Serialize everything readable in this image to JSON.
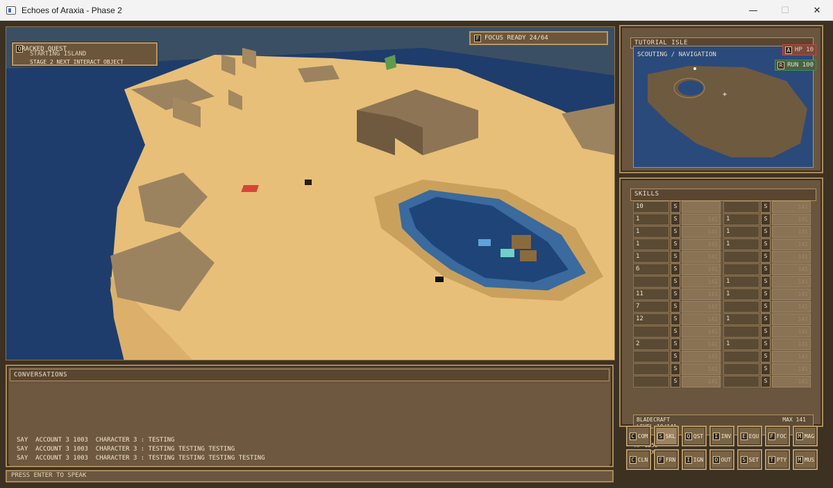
{
  "window": {
    "title": "Echoes of Araxia - Phase 2",
    "minimize": "—",
    "maximize": "☐",
    "close": "✕"
  },
  "quest": {
    "key": "Q",
    "label": "RACKED QUEST",
    "zone": "STARTING ISLAND",
    "stage": "STAGE 2  NEXT INTERACT OBJECT"
  },
  "focus": {
    "key": "F",
    "label": "FOCUS READY",
    "value": "24/64"
  },
  "minimap": {
    "title": "TUTORIAL ISLE",
    "subtitle": "SCOUTING / NAVIGATION",
    "hp": {
      "key": "A",
      "label": "HP 10",
      "color": "#cc4444"
    },
    "run": {
      "key": "R",
      "label": "RUN 100",
      "color": "#3e8f55"
    }
  },
  "skills": {
    "title": "SKILLS",
    "rows": [
      [
        {
          "lvl": "10",
          "ico": "S",
          "bar": "",
          "dim": false
        },
        {
          "lvl": "",
          "ico": "S",
          "bar": "141",
          "dim": true
        }
      ],
      [
        {
          "lvl": "1",
          "ico": "S",
          "bar": "141",
          "dim": false
        },
        {
          "lvl": "1",
          "ico": "S",
          "bar": "141",
          "dim": false
        }
      ],
      [
        {
          "lvl": "1",
          "ico": "S",
          "bar": "141",
          "dim": false
        },
        {
          "lvl": "1",
          "ico": "S",
          "bar": "141",
          "dim": false
        }
      ],
      [
        {
          "lvl": "1",
          "ico": "S",
          "bar": "141",
          "dim": false
        },
        {
          "lvl": "1",
          "ico": "S",
          "bar": "141",
          "dim": false
        }
      ],
      [
        {
          "lvl": "1",
          "ico": "S",
          "bar": "141",
          "dim": false
        },
        {
          "lvl": "",
          "ico": "S",
          "bar": "141",
          "dim": true
        }
      ],
      [
        {
          "lvl": "6",
          "ico": "S",
          "bar": "141",
          "dim": false
        },
        {
          "lvl": "",
          "ico": "S",
          "bar": "141",
          "dim": true
        }
      ],
      [
        {
          "lvl": "",
          "ico": "S",
          "bar": "141",
          "dim": true
        },
        {
          "lvl": "1",
          "ico": "S",
          "bar": "141",
          "dim": false
        }
      ],
      [
        {
          "lvl": "11",
          "ico": "S",
          "bar": "141",
          "dim": false
        },
        {
          "lvl": "1",
          "ico": "S",
          "bar": "141",
          "dim": false
        }
      ],
      [
        {
          "lvl": "7",
          "ico": "S",
          "bar": "141",
          "dim": false
        },
        {
          "lvl": "",
          "ico": "S",
          "bar": "141",
          "dim": true
        }
      ],
      [
        {
          "lvl": "12",
          "ico": "S",
          "bar": "141",
          "dim": false
        },
        {
          "lvl": "1",
          "ico": "S",
          "bar": "141",
          "dim": false
        }
      ],
      [
        {
          "lvl": "",
          "ico": "S",
          "bar": "141",
          "dim": true
        },
        {
          "lvl": "",
          "ico": "S",
          "bar": "141",
          "dim": true
        }
      ],
      [
        {
          "lvl": "2",
          "ico": "S",
          "bar": "141",
          "dim": false
        },
        {
          "lvl": "1",
          "ico": "S",
          "bar": "141",
          "dim": false
        }
      ],
      [
        {
          "lvl": "",
          "ico": "S",
          "bar": "141",
          "dim": true
        },
        {
          "lvl": "",
          "ico": "S",
          "bar": "141",
          "dim": true
        }
      ],
      [
        {
          "lvl": "",
          "ico": "S",
          "bar": "141",
          "dim": true
        },
        {
          "lvl": "",
          "ico": "S",
          "bar": "141",
          "dim": true
        }
      ],
      [
        {
          "lvl": "",
          "ico": "S",
          "bar": "141",
          "dim": true
        },
        {
          "lvl": "",
          "ico": "S",
          "bar": "141",
          "dim": true
        }
      ]
    ],
    "info": {
      "name": "BLADECRAFT",
      "max": "MAX 141",
      "level": "LEVEL 10/141",
      "total": "TOTAL 82",
      "xp": "XP 1259",
      "next": "TO NEXT 33"
    }
  },
  "buttons": [
    {
      "key": "C",
      "label": "COM"
    },
    {
      "key": "S",
      "label": "SKL",
      "active": true
    },
    {
      "key": "Q",
      "label": "QST"
    },
    {
      "key": "I",
      "label": "INV"
    },
    {
      "key": "E",
      "label": "EQU"
    },
    {
      "key": "F",
      "label": "FOC"
    },
    {
      "key": "M",
      "label": "MAG"
    },
    {
      "key": "C",
      "label": "CLN"
    },
    {
      "key": "F",
      "label": "FRN"
    },
    {
      "key": "I",
      "label": "IGN"
    },
    {
      "key": "O",
      "label": "OUT"
    },
    {
      "key": "S",
      "label": "SET"
    },
    {
      "key": "T",
      "label": "PTY"
    },
    {
      "key": "M",
      "label": "MUS"
    }
  ],
  "conversations": {
    "title": "CONVERSATIONS",
    "lines": [
      "SAY  ACCOUNT 3 1003  CHARACTER 3 : TESTING",
      "SAY  ACCOUNT 3 1003  CHARACTER 3 : TESTING TESTING TESTING",
      "SAY  ACCOUNT 3 1003  CHARACTER 3 : TESTING TESTING TESTING TESTING"
    ],
    "prompt": "PRESS ENTER TO SPEAK"
  },
  "colors": {
    "sand": "#e9c37d",
    "water": "#1f3d6b",
    "shallow": "#3d6ea0",
    "panel": "#6a563e",
    "border": "#b69869"
  }
}
